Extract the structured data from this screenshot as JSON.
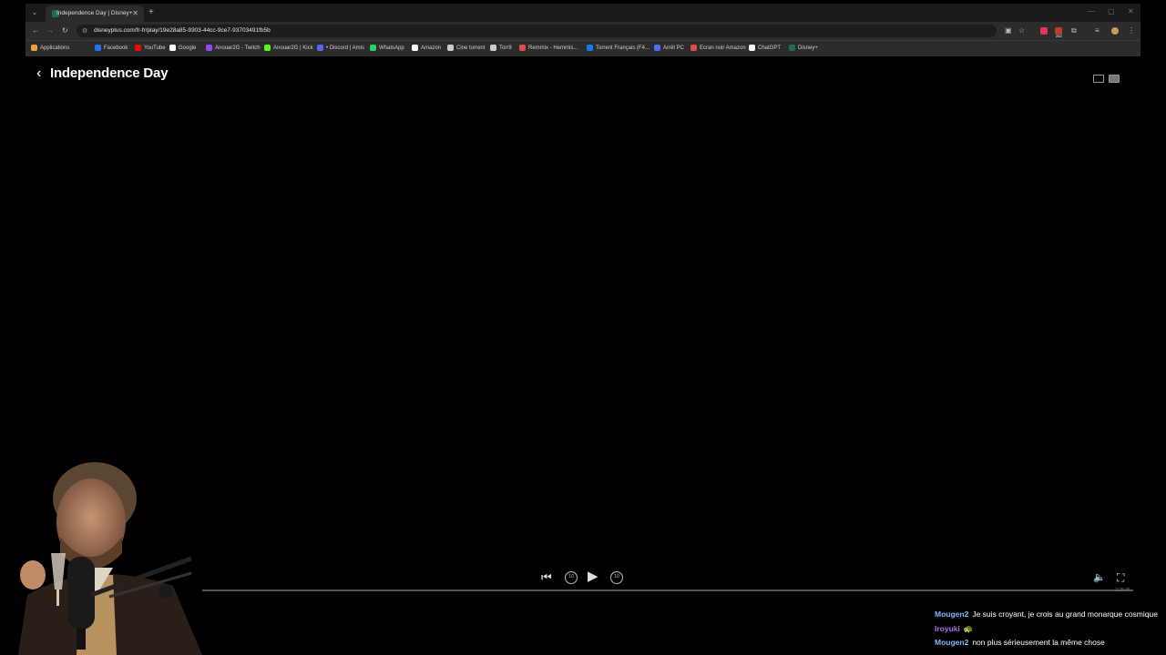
{
  "browser": {
    "tab": {
      "title": "Independence Day | Disney+"
    },
    "url": "disneyplus.com/fr-fr/play/19e28a85-9303-44cc-9ce7-93703491fb5b",
    "badge": "262",
    "bookmarks": [
      {
        "label": "Applications",
        "color": "#e8a33b"
      },
      {
        "label": "Facebook",
        "color": "#1877f2"
      },
      {
        "label": "YouTube",
        "color": "#ff0000"
      },
      {
        "label": "Google",
        "color": "#ffffff"
      },
      {
        "label": "Anouar2G - Twitch",
        "color": "#9146ff"
      },
      {
        "label": "Anouar2G | Kick",
        "color": "#53fc18"
      },
      {
        "label": "• Discord | Amis",
        "color": "#5865f2"
      },
      {
        "label": "WhatsApp",
        "color": "#25d366"
      },
      {
        "label": "Amazon",
        "color": "#ffffff"
      },
      {
        "label": "Cine torrent",
        "color": "#cccccc"
      },
      {
        "label": "Torr9",
        "color": "#cccccc"
      },
      {
        "label": "Remmix - Hemmis...",
        "color": "#e04b4b"
      },
      {
        "label": "Torrent Français (F4...",
        "color": "#1877f2"
      },
      {
        "label": "Arrêt PC",
        "color": "#4a6cff"
      },
      {
        "label": "Ecran noir Amazon",
        "color": "#e04b4b"
      },
      {
        "label": "ChatGPT",
        "color": "#ffffff"
      },
      {
        "label": "Disney+",
        "color": "#1b6e5b"
      }
    ]
  },
  "player": {
    "title": "Independence Day",
    "progress": 0,
    "timecode": "2:25:45"
  },
  "chat": [
    {
      "user": "Mougen2",
      "color": "#8ab4f8",
      "text": "Je suis croyant, je crois au grand monarque cosmique"
    },
    {
      "user": "Iroyuki",
      "color": "#b26cf0",
      "text": "🐢"
    },
    {
      "user": "Mougen2",
      "color": "#8ab4f8",
      "text": "non plus sérieusement la même chose"
    }
  ]
}
